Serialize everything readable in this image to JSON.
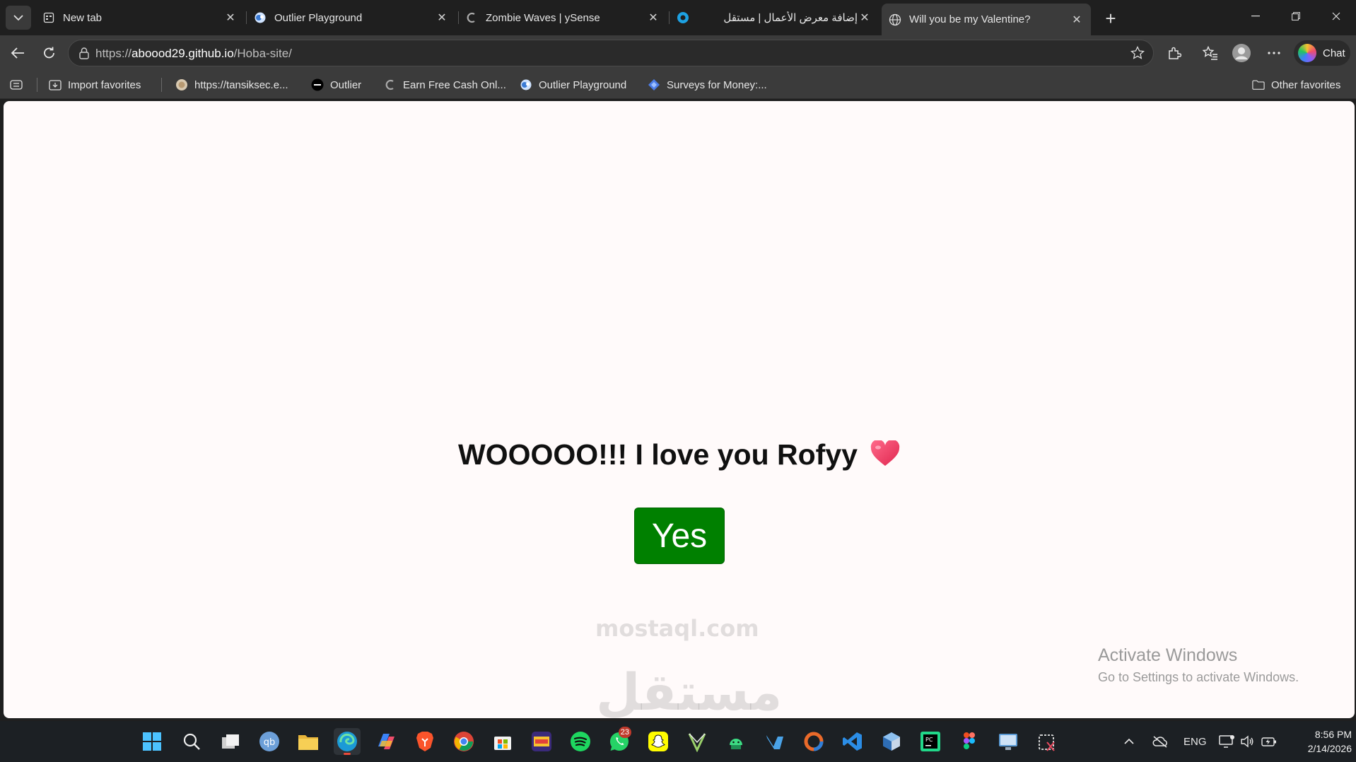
{
  "browser": {
    "tabs": [
      {
        "title": "New tab",
        "favicon": "newtab-icon",
        "active": false
      },
      {
        "title": "Outlier Playground",
        "favicon": "outlier-icon",
        "active": false
      },
      {
        "title": "Zombie Waves | ySense",
        "favicon": "ysense-icon",
        "active": false
      },
      {
        "title": "إضافة معرض الأعمال | مستقل",
        "favicon": "mostaql-icon",
        "active": false
      },
      {
        "title": "Will you be my Valentine?",
        "favicon": "globe-icon",
        "active": true
      }
    ],
    "address": {
      "prefix": "https://",
      "host": "aboood29.github.io",
      "path": "/Hoba-site/"
    },
    "chat_label": "Chat",
    "favorites": [
      {
        "label": "Import favorites",
        "icon": "import-icon"
      },
      {
        "label": "https://tansiksec.e...",
        "icon": "site-icon"
      },
      {
        "label": "Outlier",
        "icon": "outlier-dark-icon"
      },
      {
        "label": "Earn Free Cash Onl...",
        "icon": "ysense-icon"
      },
      {
        "label": "Outlier Playground",
        "icon": "outlier-icon"
      },
      {
        "label": "Surveys for Money:...",
        "icon": "surveys-icon"
      }
    ],
    "other_favorites": "Other favorites"
  },
  "page": {
    "headline": "WOOOOO!!! I love you Rofyy",
    "yes_label": "Yes",
    "accent_green": "#008000"
  },
  "overlay": {
    "activate_title": "Activate Windows",
    "activate_sub": "Go to Settings to activate Windows.",
    "watermark_ar": "مستقل",
    "watermark_en": "mostaql.com"
  },
  "taskbar": {
    "whatsapp_badge": "23",
    "language": "ENG",
    "time": "8:56 PM",
    "date": "2/14/2026"
  }
}
